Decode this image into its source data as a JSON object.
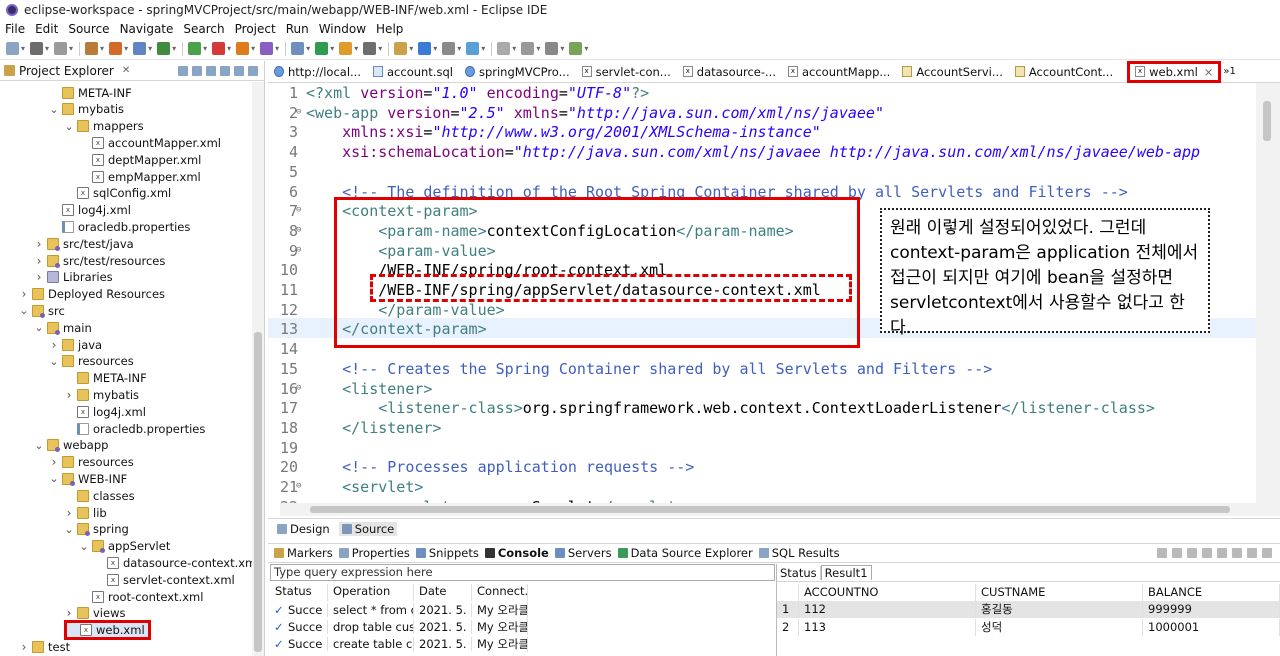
{
  "window": {
    "title": "eclipse-workspace - springMVCProject/src/main/webapp/WEB-INF/web.xml - Eclipse IDE"
  },
  "menu": [
    "File",
    "Edit",
    "Source",
    "Navigate",
    "Search",
    "Project",
    "Run",
    "Window",
    "Help"
  ],
  "explorer": {
    "tab_label": "Project Explorer",
    "items": [
      {
        "label": "META-INF",
        "indent": 3,
        "twisty": "",
        "icon": "folder"
      },
      {
        "label": "mybatis",
        "indent": 3,
        "twisty": "v",
        "icon": "folder"
      },
      {
        "label": "mappers",
        "indent": 4,
        "twisty": "v",
        "icon": "folder"
      },
      {
        "label": "accountMapper.xml",
        "indent": 5,
        "twisty": "",
        "icon": "xml"
      },
      {
        "label": "deptMapper.xml",
        "indent": 5,
        "twisty": "",
        "icon": "xml"
      },
      {
        "label": "empMapper.xml",
        "indent": 5,
        "twisty": "",
        "icon": "xml"
      },
      {
        "label": "sqlConfig.xml",
        "indent": 4,
        "twisty": "",
        "icon": "xml"
      },
      {
        "label": "log4j.xml",
        "indent": 3,
        "twisty": "",
        "icon": "xml"
      },
      {
        "label": "oracledb.properties",
        "indent": 3,
        "twisty": "",
        "icon": "prop"
      },
      {
        "label": "src/test/java",
        "indent": 2,
        "twisty": ">",
        "icon": "pkg"
      },
      {
        "label": "src/test/resources",
        "indent": 2,
        "twisty": ">",
        "icon": "pkg"
      },
      {
        "label": "Libraries",
        "indent": 2,
        "twisty": ">",
        "icon": "lib"
      },
      {
        "label": "Deployed Resources",
        "indent": 1,
        "twisty": ">",
        "icon": "proj"
      },
      {
        "label": "src",
        "indent": 1,
        "twisty": "v",
        "icon": "pkg"
      },
      {
        "label": "main",
        "indent": 2,
        "twisty": "v",
        "icon": "pkg"
      },
      {
        "label": "java",
        "indent": 3,
        "twisty": ">",
        "icon": "folder"
      },
      {
        "label": "resources",
        "indent": 3,
        "twisty": "v",
        "icon": "folder"
      },
      {
        "label": "META-INF",
        "indent": 4,
        "twisty": "",
        "icon": "folder"
      },
      {
        "label": "mybatis",
        "indent": 4,
        "twisty": ">",
        "icon": "folder"
      },
      {
        "label": "log4j.xml",
        "indent": 4,
        "twisty": "",
        "icon": "xml"
      },
      {
        "label": "oracledb.properties",
        "indent": 4,
        "twisty": "",
        "icon": "prop"
      },
      {
        "label": "webapp",
        "indent": 2,
        "twisty": "v",
        "icon": "pkg"
      },
      {
        "label": "resources",
        "indent": 3,
        "twisty": ">",
        "icon": "folder"
      },
      {
        "label": "WEB-INF",
        "indent": 3,
        "twisty": "v",
        "icon": "pkg"
      },
      {
        "label": "classes",
        "indent": 4,
        "twisty": "",
        "icon": "folder"
      },
      {
        "label": "lib",
        "indent": 4,
        "twisty": ">",
        "icon": "folder"
      },
      {
        "label": "spring",
        "indent": 4,
        "twisty": "v",
        "icon": "pkg"
      },
      {
        "label": "appServlet",
        "indent": 5,
        "twisty": "v",
        "icon": "pkg"
      },
      {
        "label": "datasource-context.xml",
        "indent": 6,
        "twisty": "",
        "icon": "xmlp"
      },
      {
        "label": "servlet-context.xml",
        "indent": 6,
        "twisty": "",
        "icon": "xmlp"
      },
      {
        "label": "root-context.xml",
        "indent": 5,
        "twisty": "",
        "icon": "xmlp"
      },
      {
        "label": "views",
        "indent": 4,
        "twisty": ">",
        "icon": "folder"
      },
      {
        "label": "web.xml",
        "indent": 4,
        "twisty": "",
        "icon": "xml",
        "highlight": true
      },
      {
        "label": "test",
        "indent": 1,
        "twisty": ">",
        "icon": "folder"
      }
    ]
  },
  "editor_tabs": [
    {
      "label": "http://local...",
      "icon": "w"
    },
    {
      "label": "account.sql",
      "icon": "s"
    },
    {
      "label": "springMVCPro...",
      "icon": "w"
    },
    {
      "label": "servlet-con...",
      "icon": "x"
    },
    {
      "label": "datasource-...",
      "icon": "x"
    },
    {
      "label": "accountMapp...",
      "icon": "x"
    },
    {
      "label": "AccountServi...",
      "icon": "j"
    },
    {
      "label": "AccountCont...",
      "icon": "j"
    },
    {
      "label": "web.xml",
      "icon": "x",
      "active": true,
      "close": "×"
    }
  ],
  "editor_overflow": "»1",
  "code_lines": [
    {
      "n": "1",
      "html": "<span class='tag'>&lt;?xml</span> <span class='attr'>version</span>=<span class='val'>\"1.0\"</span> <span class='attr'>encoding</span>=<span class='val'>\"UTF-8\"</span><span class='tag'>?&gt;</span>"
    },
    {
      "n": "2",
      "html": "<span class='tag'>&lt;web-app</span> <span class='attr'>version</span>=<span class='val'>\"2.5\"</span> <span class='attr'>xmlns</span>=<span class='val'>\"http://java.sun.com/xml/ns/javaee\"</span>"
    },
    {
      "n": "3",
      "html": "    <span class='attr'>xmlns:xsi</span>=<span class='val'>\"http://www.w3.org/2001/XMLSchema-instance\"</span>"
    },
    {
      "n": "4",
      "html": "    <span class='attr'>xsi:schemaLocation</span>=<span class='val'>\"http://java.sun.com/xml/ns/javaee http://java.sun.com/xml/ns/javaee/web-app</span>"
    },
    {
      "n": "5",
      "html": ""
    },
    {
      "n": "6",
      "html": "    <span class='com'>&lt;!-- The definition of the Root Spring Container shared by all Servlets and Filters --&gt;</span>"
    },
    {
      "n": "7",
      "html": "    <span class='tag'>&lt;context-param&gt;</span>"
    },
    {
      "n": "8",
      "html": "        <span class='tag'>&lt;param-name&gt;</span>contextConfigLocation<span class='tag'>&lt;/param-name&gt;</span>"
    },
    {
      "n": "9",
      "html": "        <span class='tag'>&lt;param-value&gt;</span>"
    },
    {
      "n": "10",
      "html": "        /WEB-INF/spring/root-context.xml"
    },
    {
      "n": "11",
      "html": "        /WEB-INF/spring/appServlet/datasource-context.xml"
    },
    {
      "n": "12",
      "html": "        <span class='tag'>&lt;/param-value&gt;</span>"
    },
    {
      "n": "13",
      "html": "    <span class='tag'>&lt;/context-param&gt;</span>"
    },
    {
      "n": "14",
      "html": ""
    },
    {
      "n": "15",
      "html": "    <span class='com'>&lt;!-- Creates the Spring Container shared by all Servlets and Filters --&gt;</span>"
    },
    {
      "n": "16",
      "html": "    <span class='tag'>&lt;listener&gt;</span>"
    },
    {
      "n": "17",
      "html": "        <span class='tag'>&lt;listener-class&gt;</span>org.springframework.web.context.ContextLoaderListener<span class='tag'>&lt;/listener-class&gt;</span>"
    },
    {
      "n": "18",
      "html": "    <span class='tag'>&lt;/listener&gt;</span>"
    },
    {
      "n": "19",
      "html": ""
    },
    {
      "n": "20",
      "html": "    <span class='com'>&lt;!-- Processes application requests --&gt;</span>"
    },
    {
      "n": "21",
      "html": "    <span class='tag'>&lt;servlet&gt;</span>"
    },
    {
      "n": "22",
      "html": "        <span class='tag'>&lt;servlet-name&gt;</span>appServlet<span class='tag'>&lt;/servlet-name&gt;</span>"
    }
  ],
  "note": "원래 이렇게 설정되어있었다. 그런데 context-param은 application 전체에서 접근이 되지만 여기에 bean을 설정하면 servletcontext에서 사용할수 없다고 한다.",
  "design_tabs": [
    "Design",
    "Source"
  ],
  "bottom_tabs": [
    "Markers",
    "Properties",
    "Snippets",
    "Console",
    "Servers",
    "Data Source Explorer",
    "SQL Results"
  ],
  "sql": {
    "query_placeholder": "Type query expression here",
    "history_headers": [
      "Status",
      "Operation",
      "Date",
      "Connect..."
    ],
    "history_rows": [
      [
        "Succe",
        "select * from c...",
        "2021. 5. ...",
        "My 오라클"
      ],
      [
        "Succe",
        "drop table cus...",
        "2021. 5. ...",
        "My 오라클"
      ],
      [
        "Succe",
        "create table cu...",
        "2021. 5. ...",
        "My 오라클"
      ]
    ],
    "result_tabs": [
      "Status",
      "Result1"
    ],
    "result_headers": [
      "",
      "ACCOUNTNO",
      "CUSTNAME",
      "BALANCE"
    ],
    "result_rows": [
      [
        "1",
        "112",
        "홍길동",
        "999999"
      ],
      [
        "2",
        "113",
        "성덕",
        "1000001"
      ]
    ]
  }
}
